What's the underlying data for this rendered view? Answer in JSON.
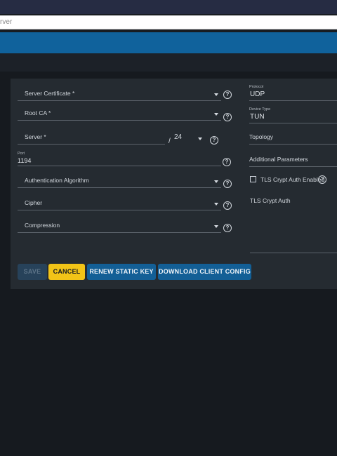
{
  "browser": {
    "url_fragment": "rver"
  },
  "form": {
    "server_certificate": {
      "label": "Server Certificate *"
    },
    "root_ca": {
      "label": "Root CA *"
    },
    "server": {
      "label": "Server *",
      "separator": "/",
      "netmask": "24"
    },
    "port": {
      "label": "Port",
      "value": "1194"
    },
    "auth_algorithm": {
      "label": "Authentication Algorithm"
    },
    "cipher": {
      "label": "Cipher"
    },
    "compression": {
      "label": "Compression"
    },
    "protocol": {
      "label": "Protocol",
      "value": "UDP"
    },
    "device_type": {
      "label": "Device Type",
      "value": "TUN"
    },
    "topology": {
      "label": "Topology"
    },
    "additional_parameters": {
      "label": "Additional Parameters"
    },
    "tls_crypt_enabled": {
      "label": "TLS Crypt Auth Enabled",
      "checked": false
    },
    "tls_crypt_auth": {
      "label": "TLS Crypt Auth",
      "value": ""
    }
  },
  "buttons": {
    "save": "SAVE",
    "cancel": "CANCEL",
    "renew": "RENEW STATIC KEY",
    "download": "DOWNLOAD CLIENT CONFIG"
  },
  "icons": {
    "help": "?"
  },
  "colors": {
    "brand_blue": "#10629c",
    "button_blue": "#135f96",
    "cancel_yellow": "#f2c417",
    "save_disabled": "#27425a",
    "card_bg": "#252b31",
    "page_bg": "#161a1f"
  }
}
